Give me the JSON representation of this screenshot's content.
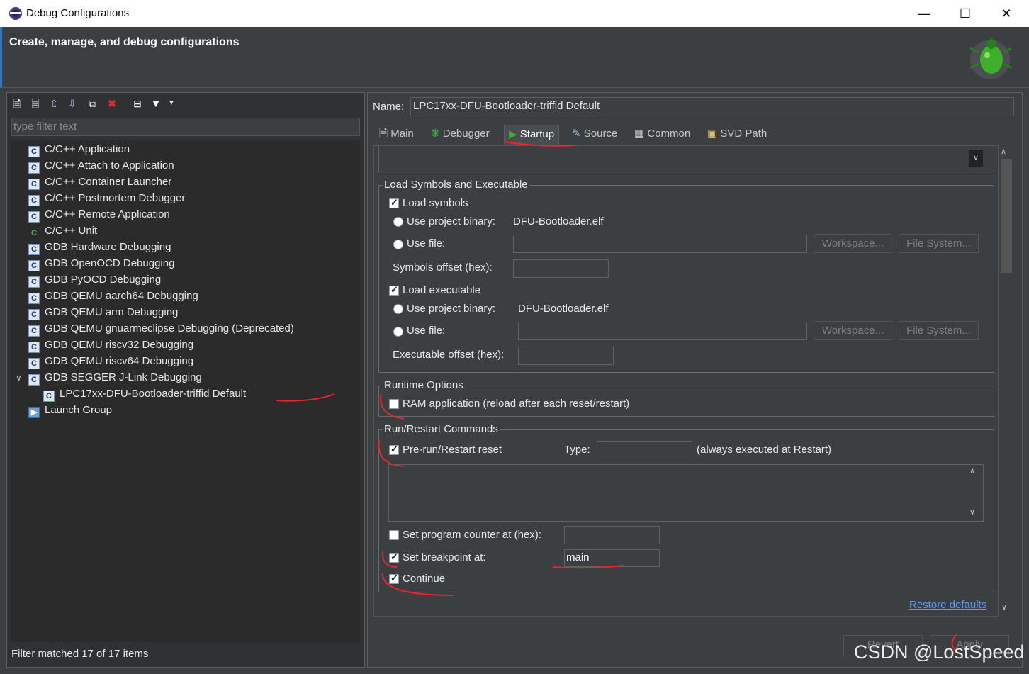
{
  "window": {
    "title": "Debug Configurations"
  },
  "header": {
    "title": "Create, manage, and debug configurations"
  },
  "left": {
    "filter_placeholder": "type filter text",
    "tree": [
      {
        "label": "C/C++ Application"
      },
      {
        "label": "C/C++ Attach to Application"
      },
      {
        "label": "C/C++ Container Launcher"
      },
      {
        "label": "C/C++ Postmortem Debugger"
      },
      {
        "label": "C/C++ Remote Application"
      },
      {
        "label": "C/C++ Unit"
      },
      {
        "label": "GDB Hardware Debugging"
      },
      {
        "label": "GDB OpenOCD Debugging"
      },
      {
        "label": "GDB PyOCD Debugging"
      },
      {
        "label": "GDB QEMU aarch64 Debugging"
      },
      {
        "label": "GDB QEMU arm Debugging"
      },
      {
        "label": "GDB QEMU gnuarmeclipse Debugging (Deprecated)"
      },
      {
        "label": "GDB QEMU riscv32 Debugging"
      },
      {
        "label": "GDB QEMU riscv64 Debugging"
      },
      {
        "label": "GDB SEGGER J-Link Debugging"
      },
      {
        "label": "LPC17xx-DFU-Bootloader-triffid Default"
      },
      {
        "label": "Launch Group"
      }
    ],
    "status": "Filter matched 17 of 17 items"
  },
  "right": {
    "name_label": "Name:",
    "name_value": "LPC17xx-DFU-Bootloader-triffid Default",
    "tabs": [
      "Main",
      "Debugger",
      "Startup",
      "Source",
      "Common",
      "SVD Path"
    ],
    "load": {
      "group": "Load Symbols and Executable",
      "load_symbols": "Load symbols",
      "use_project_binary": "Use project binary:",
      "binary_symbols": "DFU-Bootloader.elf",
      "use_file": "Use file:",
      "workspace": "Workspace...",
      "file_system": "File System...",
      "symbols_offset": "Symbols offset (hex):",
      "load_executable": "Load executable",
      "binary_exec": "DFU-Bootloader.elf",
      "executable_offset": "Executable offset (hex):"
    },
    "runtime": {
      "group": "Runtime Options",
      "ram_app": "RAM application (reload after each reset/restart)"
    },
    "run": {
      "group": "Run/Restart Commands",
      "prerun": "Pre-run/Restart reset",
      "type_label": "Type:",
      "always": "(always executed at Restart)",
      "set_pc": "Set program counter at (hex):",
      "set_bp": "Set breakpoint at:",
      "bp_value": "main",
      "continue": "Continue"
    },
    "restore_defaults": "Restore defaults",
    "revert": "Revert",
    "apply": "Apply"
  },
  "watermark": "CSDN @LostSpeed"
}
